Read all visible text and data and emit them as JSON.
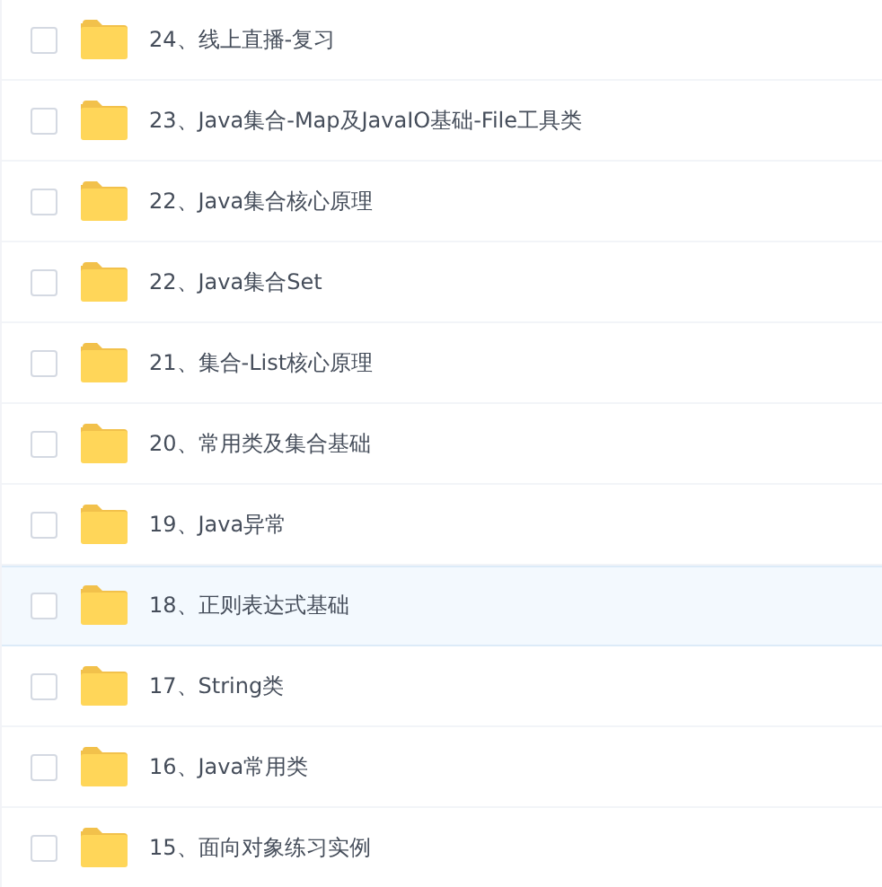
{
  "files": [
    {
      "name": "24、线上直播-复习",
      "checked": false,
      "highlighted": false
    },
    {
      "name": "23、Java集合-Map及JavaIO基础-File工具类",
      "checked": false,
      "highlighted": false
    },
    {
      "name": "22、Java集合核心原理",
      "checked": false,
      "highlighted": false
    },
    {
      "name": "22、Java集合Set",
      "checked": false,
      "highlighted": false
    },
    {
      "name": "21、集合-List核心原理",
      "checked": false,
      "highlighted": false
    },
    {
      "name": "20、常用类及集合基础",
      "checked": false,
      "highlighted": false
    },
    {
      "name": "19、Java异常",
      "checked": false,
      "highlighted": false
    },
    {
      "name": "18、正则表达式基础",
      "checked": false,
      "highlighted": true
    },
    {
      "name": "17、String类",
      "checked": false,
      "highlighted": false
    },
    {
      "name": "16、Java常用类",
      "checked": false,
      "highlighted": false
    },
    {
      "name": "15、面向对象练习实例",
      "checked": false,
      "highlighted": false
    }
  ]
}
